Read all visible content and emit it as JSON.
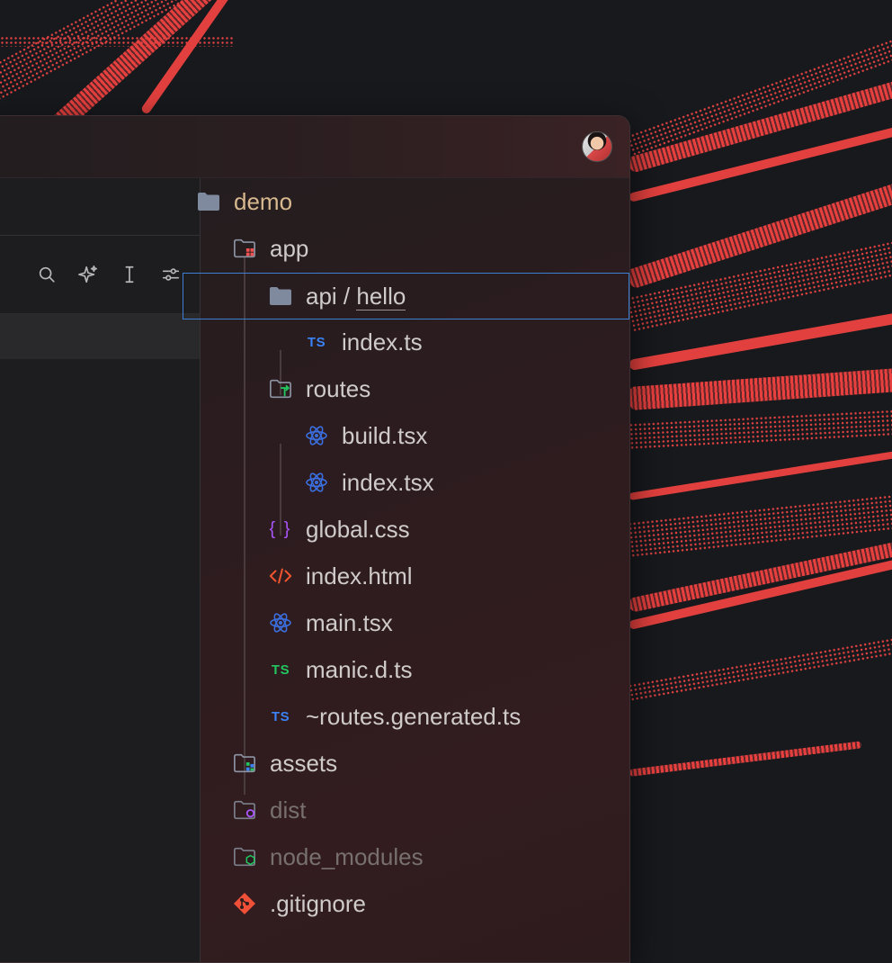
{
  "window": {
    "avatar_alt": "user avatar"
  },
  "toolbar": {
    "icons": [
      "search-icon",
      "sparkle-icon",
      "text-cursor-icon",
      "sliders-icon"
    ]
  },
  "tree": {
    "items": [
      {
        "label": "demo",
        "icon": "folder-icon",
        "depth": 0
      },
      {
        "label": "app",
        "icon": "app-folder-icon",
        "depth": 1
      },
      {
        "label_prefix": "api / ",
        "label": "hello",
        "icon": "folder-icon",
        "depth": 2,
        "selected": true
      },
      {
        "label": "index.ts",
        "icon": "typescript-icon",
        "icon_text": "TS",
        "depth": 3
      },
      {
        "label": "routes",
        "icon": "routes-folder-icon",
        "depth": 2
      },
      {
        "label": "build.tsx",
        "icon": "react-icon",
        "depth": 3
      },
      {
        "label": "index.tsx",
        "icon": "react-icon",
        "depth": 3
      },
      {
        "label": "global.css",
        "icon": "css-icon",
        "icon_text": "{ }",
        "depth": 2
      },
      {
        "label": "index.html",
        "icon": "html-icon",
        "depth": 2
      },
      {
        "label": "main.tsx",
        "icon": "react-icon",
        "depth": 2
      },
      {
        "label": "manic.d.ts",
        "icon": "typescript-def-icon",
        "icon_text": "TS",
        "depth": 2
      },
      {
        "label": "~routes.generated.ts",
        "icon": "typescript-icon",
        "icon_text": "TS",
        "depth": 2
      },
      {
        "label": "assets",
        "icon": "assets-folder-icon",
        "depth": 1
      },
      {
        "label": "dist",
        "icon": "dist-folder-icon",
        "depth": 1,
        "dimmed": true
      },
      {
        "label": "node_modules",
        "icon": "node-folder-icon",
        "depth": 1,
        "dimmed": true
      },
      {
        "label": ".gitignore",
        "icon": "git-icon",
        "depth": 1
      }
    ]
  },
  "colors": {
    "accent_selection": "#3e7fd6",
    "wallpaper_red": "#e2403e",
    "ts_blue": "#3b82f6",
    "ts_green": "#22c55e",
    "css_purple": "#a855f7",
    "html_orange": "#f0552f",
    "react_blue": "#3b6fe0",
    "git_red": "#f05038",
    "root_label": "#d8b98f"
  }
}
